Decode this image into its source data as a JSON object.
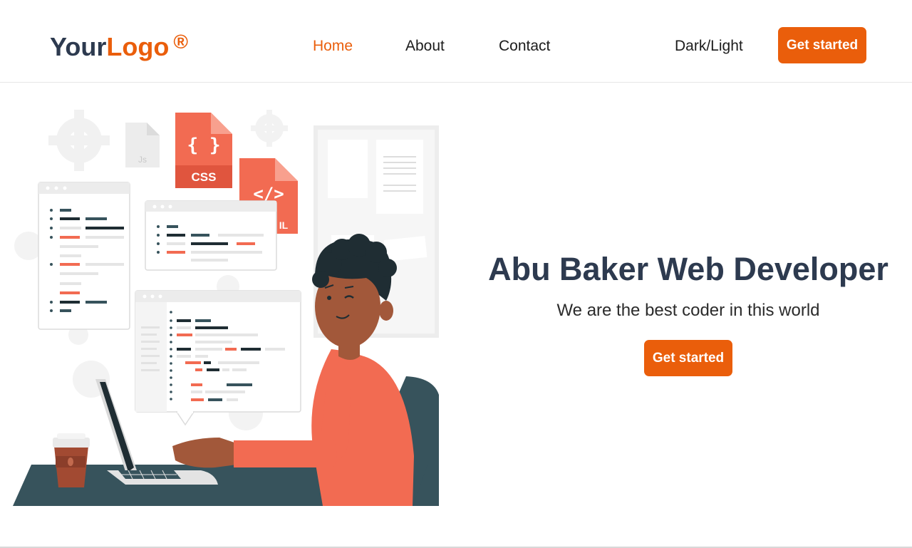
{
  "brand": {
    "logo_part1": "Your",
    "logo_part2": "Logo",
    "logo_mark": "®"
  },
  "nav": {
    "items": [
      {
        "label": "Home",
        "active": true
      },
      {
        "label": "About",
        "active": false
      },
      {
        "label": "Contact",
        "active": false
      }
    ],
    "theme_toggle_label": "Dark/Light",
    "cta_label": "Get started"
  },
  "hero": {
    "title": "Abu Baker Web Developer",
    "subtitle": "We are the best coder in this world",
    "cta_label": "Get started"
  },
  "illustration": {
    "subject": "developer-at-laptop",
    "file_labels": {
      "js": "Js",
      "js_big": "JS",
      "css": "CSS",
      "css_icon": "{ }",
      "html_icon": "</>",
      "html_partial": "IL"
    }
  },
  "colors": {
    "accent": "#ea5e0b",
    "text_dark": "#2d3a4f",
    "illustration_orange": "#f26b52",
    "illustration_teal": "#37535c"
  }
}
